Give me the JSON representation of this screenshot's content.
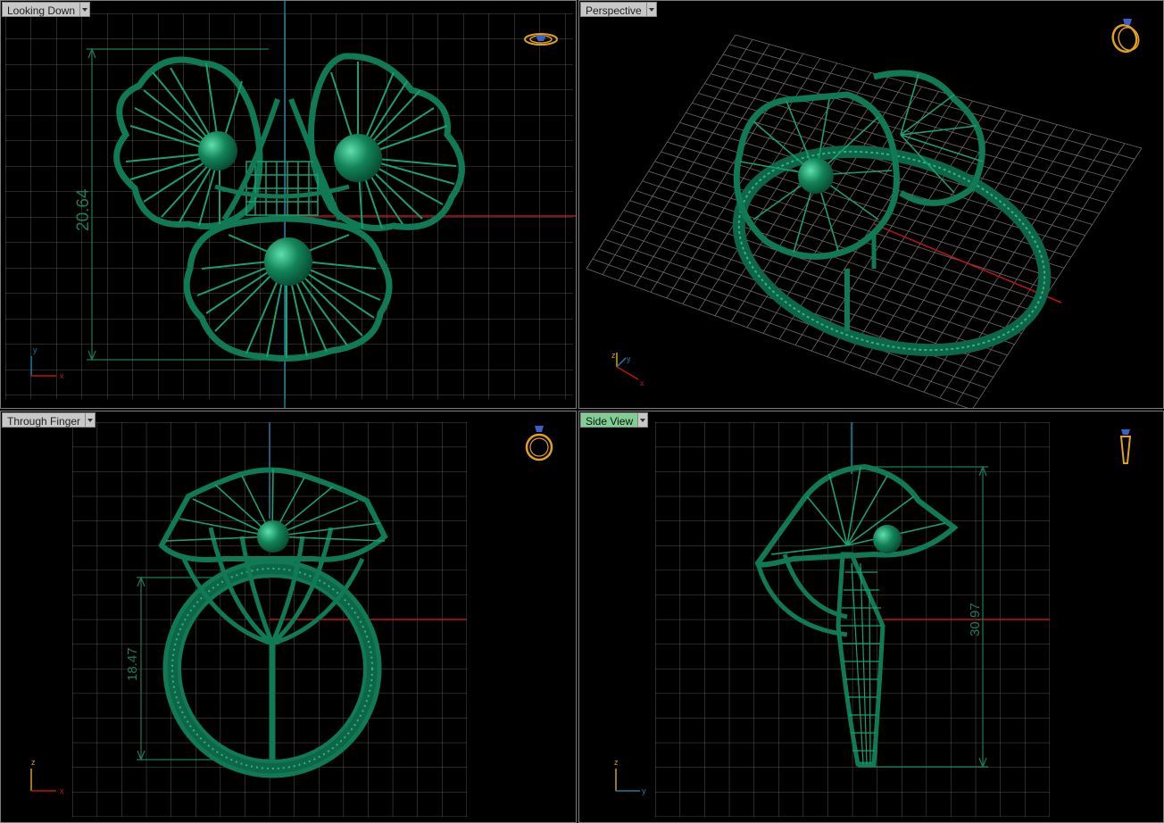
{
  "viewports": [
    {
      "id": "top",
      "label": "Looking Down",
      "active": false,
      "dimension": "20.64",
      "axes": [
        "y",
        "x"
      ]
    },
    {
      "id": "persp",
      "label": "Perspective",
      "active": false,
      "axes": [
        "z",
        "y",
        "x"
      ]
    },
    {
      "id": "front",
      "label": "Through Finger",
      "active": false,
      "dimension": "18.47",
      "axes": [
        "z",
        "x"
      ]
    },
    {
      "id": "side",
      "label": "Side View",
      "active": true,
      "dimension": "30.97",
      "axes": [
        "z",
        "y"
      ]
    }
  ],
  "colors": {
    "model": "#0f7a55",
    "model_light": "#2fb583",
    "grid": "#6e6e6e",
    "dimension": "#1f7a58",
    "axis_red": "#c0140f",
    "axis_blue": "#1a7ea0",
    "nav_icon": "#e0a020"
  },
  "icons": [
    "ring-top-view-icon",
    "ring-perspective-icon",
    "ring-front-view-icon",
    "ring-side-view-icon"
  ]
}
